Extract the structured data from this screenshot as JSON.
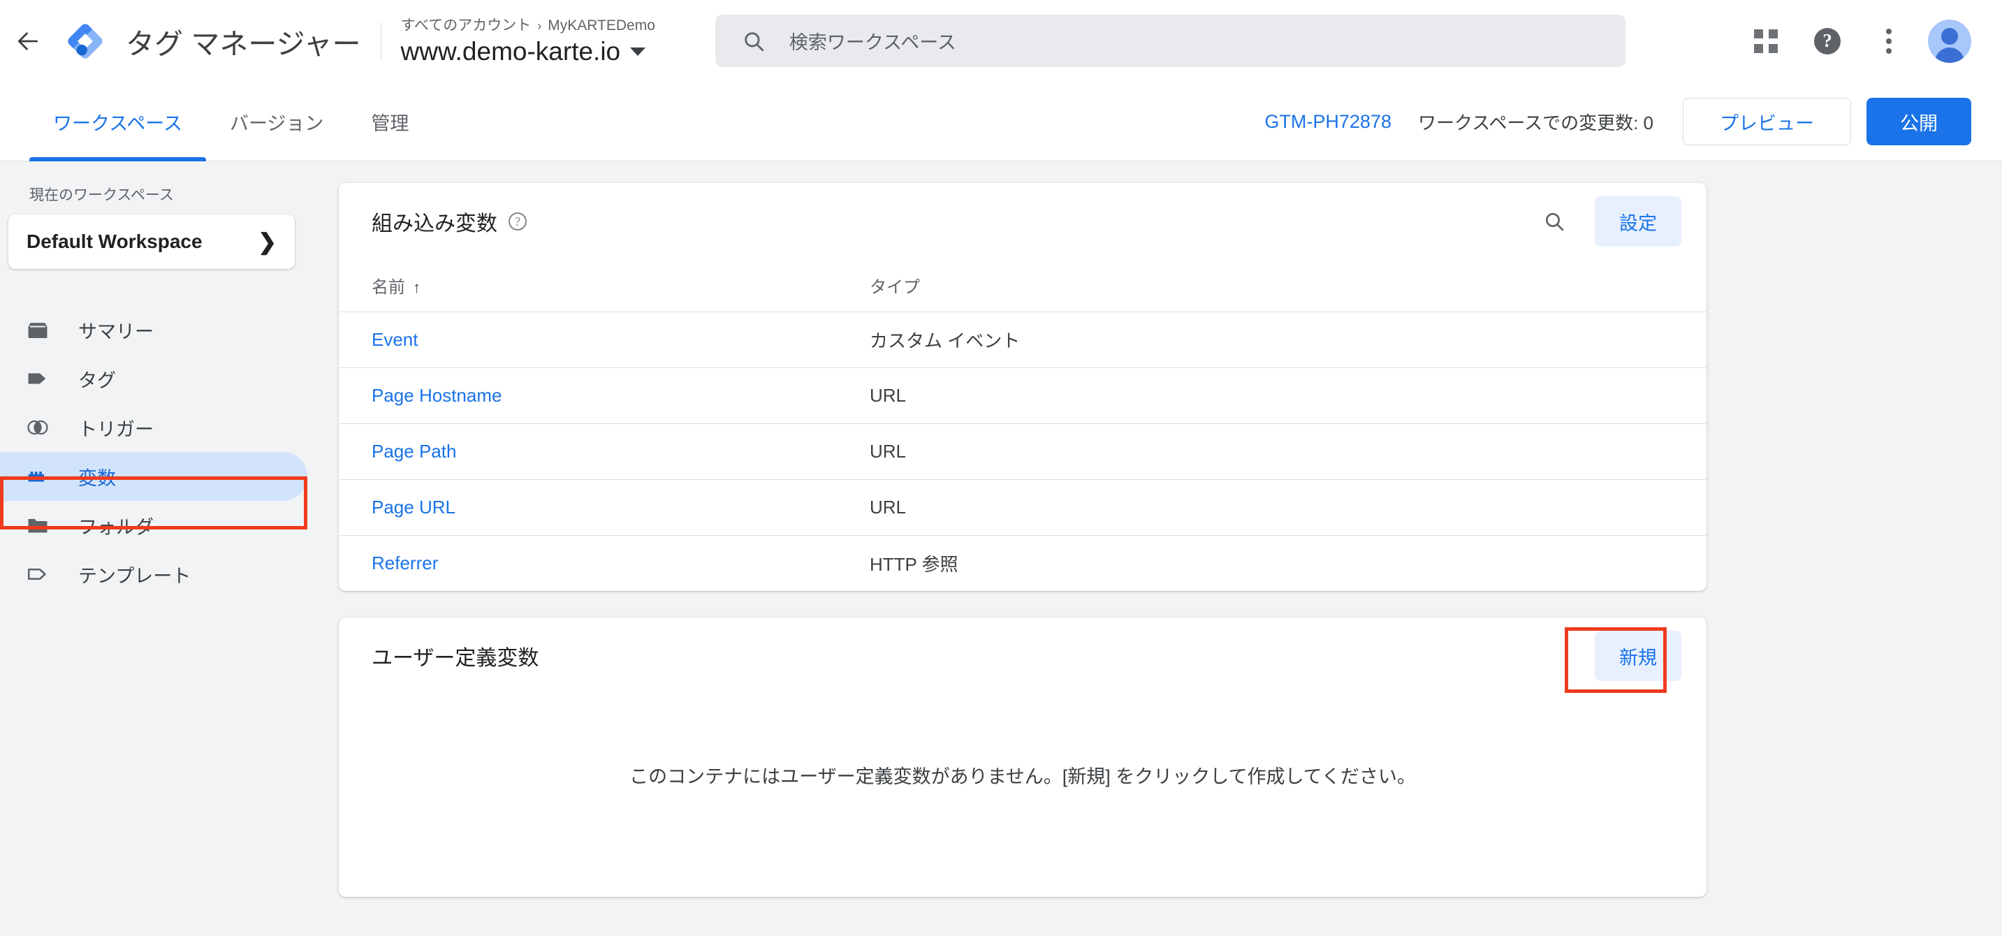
{
  "topbar": {
    "back_icon": "back-arrow-icon",
    "logo_icon": "tag-manager-logo",
    "product_title": "タグ マネージャー",
    "breadcrumb_account": "すべてのアカウント",
    "breadcrumb_separator": "›",
    "breadcrumb_container": "MyKARTEDemo",
    "container_name": "www.demo-karte.io",
    "search_placeholder": "検索ワークスペース",
    "search_icon": "search-icon",
    "apps_icon": "apps-grid-icon",
    "help_icon": "help-icon",
    "help_glyph": "?",
    "more_icon": "more-vert-icon",
    "avatar_icon": "user-avatar"
  },
  "tabs": [
    {
      "label": "ワークスペース",
      "active": true
    },
    {
      "label": "バージョン",
      "active": false
    },
    {
      "label": "管理",
      "active": false
    }
  ],
  "tabbar_right": {
    "gtm_id": "GTM-PH72878",
    "changes_label": "ワークスペースでの変更数: 0",
    "preview_label": "プレビュー",
    "publish_label": "公開"
  },
  "sidebar": {
    "current_workspace_label": "現在のワークスペース",
    "workspace_name": "Default Workspace",
    "chevron_glyph": "❯",
    "items": [
      {
        "label": "サマリー",
        "icon": "summary-box-icon",
        "active": false
      },
      {
        "label": "タグ",
        "icon": "tag-icon",
        "active": false
      },
      {
        "label": "トリガー",
        "icon": "trigger-circles-icon",
        "active": false
      },
      {
        "label": "変数",
        "icon": "variable-blocks-icon",
        "active": true
      },
      {
        "label": "フォルダ",
        "icon": "folder-icon",
        "active": false
      },
      {
        "label": "テンプレート",
        "icon": "template-outline-icon",
        "active": false
      }
    ]
  },
  "builtin_card": {
    "title": "組み込み変数",
    "help_glyph": "?",
    "search_icon": "search-icon",
    "config_label": "設定",
    "columns": [
      "名前",
      "タイプ"
    ],
    "sort_arrow": "↑",
    "rows": [
      {
        "name": "Event",
        "type": "カスタム イベント"
      },
      {
        "name": "Page Hostname",
        "type": "URL"
      },
      {
        "name": "Page Path",
        "type": "URL"
      },
      {
        "name": "Page URL",
        "type": "URL"
      },
      {
        "name": "Referrer",
        "type": "HTTP 参照"
      }
    ]
  },
  "userdef_card": {
    "title": "ユーザー定義変数",
    "new_label": "新規",
    "empty_message": "このコンテナにはユーザー定義変数がありません。[新規] をクリックして作成してください。"
  },
  "colors": {
    "accent_blue": "#1a73e8",
    "link_blue": "#1a73e8",
    "highlight_red": "#ef3b1f",
    "sidebar_active_bg": "#d2e3fc",
    "page_bg": "#f1f3f4"
  }
}
